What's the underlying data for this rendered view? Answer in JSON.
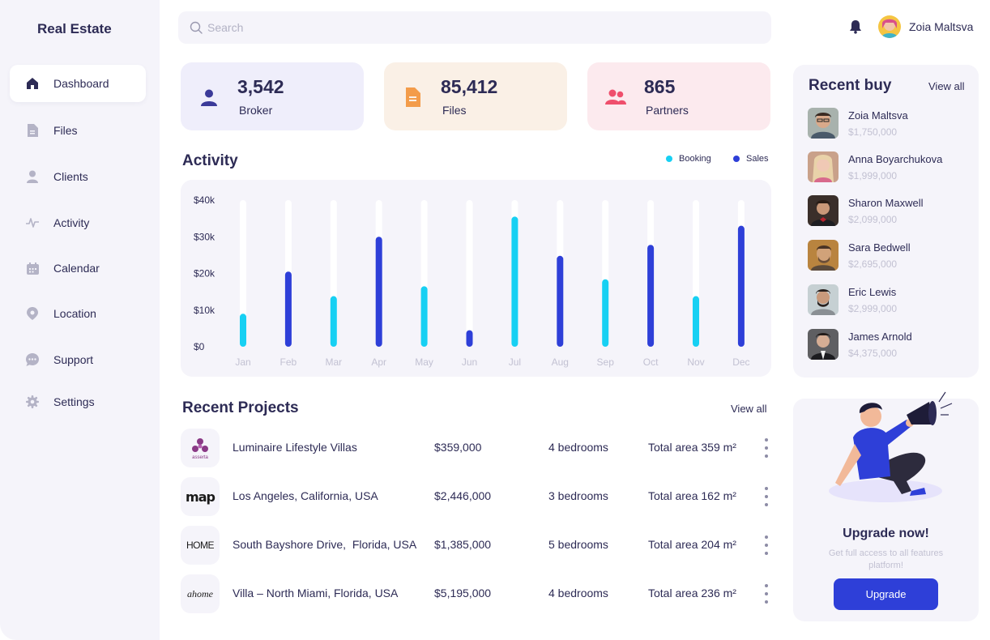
{
  "brand": "Real Estate",
  "sidebar": {
    "items": [
      {
        "label": "Dashboard",
        "icon": "home-icon",
        "active": true
      },
      {
        "label": "Files",
        "icon": "file-icon"
      },
      {
        "label": "Clients",
        "icon": "user-icon"
      },
      {
        "label": "Activity",
        "icon": "activity-icon"
      },
      {
        "label": "Calendar",
        "icon": "calendar-icon"
      },
      {
        "label": "Location",
        "icon": "location-pin-icon"
      },
      {
        "label": "Support",
        "icon": "chat-icon"
      },
      {
        "label": "Settings",
        "icon": "gear-icon"
      }
    ]
  },
  "search": {
    "placeholder": "Search"
  },
  "user": {
    "name": "Zoia Maltsva"
  },
  "stats": [
    {
      "value": "3,542",
      "label": "Broker",
      "icon": "user-icon",
      "bg": "#efeefb",
      "color": "#3b3a99"
    },
    {
      "value": "85,412",
      "label": "Files",
      "icon": "file-icon",
      "bg": "#faf0e6",
      "color": "#f39c4a"
    },
    {
      "value": "865",
      "label": "Partners",
      "icon": "users-icon",
      "bg": "#fceaee",
      "color": "#ef4f6c"
    }
  ],
  "activity": {
    "title": "Activity",
    "legend": [
      {
        "name": "Booking",
        "color": "#17d0f3"
      },
      {
        "name": "Sales",
        "color": "#2e3fd8"
      }
    ]
  },
  "chart_data": {
    "type": "bar",
    "categories": [
      "Jan",
      "Feb",
      "Mar",
      "Apr",
      "May",
      "Jun",
      "Jul",
      "Aug",
      "Sep",
      "Oct",
      "Nov",
      "Dec"
    ],
    "values": [
      9000,
      20500,
      13800,
      30000,
      16500,
      4500,
      35500,
      24800,
      18400,
      27800,
      13800,
      33000
    ],
    "series_by_bar": [
      "Booking",
      "Sales",
      "Booking",
      "Sales",
      "Booking",
      "Sales",
      "Booking",
      "Sales",
      "Booking",
      "Sales",
      "Booking",
      "Sales"
    ],
    "yticks": [
      "$0",
      "$10k",
      "$20k",
      "$30k",
      "$40k"
    ],
    "ylim": [
      0,
      40000
    ],
    "grid": false
  },
  "recent_projects": {
    "title": "Recent Projects",
    "view_all": "View all",
    "rows": [
      {
        "name": "Luminaire Lifestyle Villas",
        "price": "$359,000",
        "beds": "4 bedrooms",
        "area": "Total area 359 m²",
        "logo": "asserta",
        "logo_sub": "asserta"
      },
      {
        "name": "Los Angeles, California, USA",
        "price": "$2,446,000",
        "beds": "3 bedrooms",
        "area": "Total area 162 m²",
        "logo": "map",
        "logo_text": "map"
      },
      {
        "name": "South Bayshore Drive,  Florida, USA",
        "price": "$1,385,000",
        "beds": "5 bedrooms",
        "area": "Total area 204 m²",
        "logo": "home",
        "logo_text": "HOME"
      },
      {
        "name": "Villa – North Miami, Florida, USA",
        "price": "$5,195,000",
        "beds": "4 bedrooms",
        "area": "Total area 236 m²",
        "logo": "ahome",
        "logo_text": "ahome"
      }
    ]
  },
  "recent_buy": {
    "title": "Recent buy",
    "view_all": "View all",
    "items": [
      {
        "name": "Zoia Maltsva",
        "amount": "$1,750,000"
      },
      {
        "name": "Anna Boyarchukova",
        "amount": "$1,999,000"
      },
      {
        "name": "Sharon Maxwell",
        "amount": "$2,099,000"
      },
      {
        "name": "Sara Bedwell",
        "amount": "$2,695,000"
      },
      {
        "name": "Eric Lewis",
        "amount": "$2,999,000"
      },
      {
        "name": "James Arnold",
        "amount": "$4,375,000"
      }
    ]
  },
  "upgrade": {
    "title": "Upgrade now!",
    "description": "Get full access to all features platform!",
    "button": "Upgrade"
  }
}
